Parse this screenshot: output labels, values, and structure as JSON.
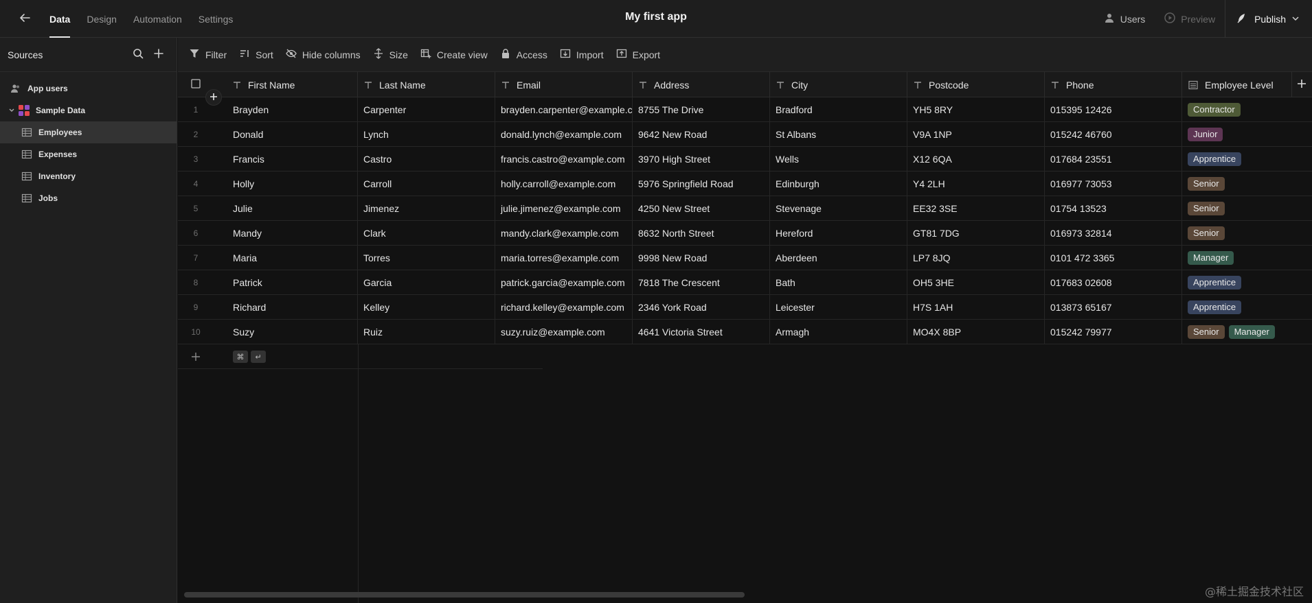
{
  "header": {
    "tabs": [
      "Data",
      "Design",
      "Automation",
      "Settings"
    ],
    "app_title": "My first app",
    "users_label": "Users",
    "preview_label": "Preview",
    "publish_label": "Publish"
  },
  "sidebar": {
    "title": "Sources",
    "items": [
      {
        "label": "App users",
        "icon": "users-icon"
      },
      {
        "label": "Sample Data",
        "icon": "database-icon"
      },
      {
        "label": "Employees",
        "icon": "table-icon"
      },
      {
        "label": "Expenses",
        "icon": "table-icon"
      },
      {
        "label": "Inventory",
        "icon": "table-icon"
      },
      {
        "label": "Jobs",
        "icon": "table-icon"
      }
    ]
  },
  "toolbar": {
    "filter": "Filter",
    "sort": "Sort",
    "hide_columns": "Hide columns",
    "size": "Size",
    "create_view": "Create view",
    "access": "Access",
    "import": "Import",
    "export": "Export"
  },
  "table": {
    "columns": [
      "First Name",
      "Last Name",
      "Email",
      "Address",
      "City",
      "Postcode",
      "Phone",
      "Employee Level"
    ],
    "rows": [
      {
        "n": "1",
        "first": "Brayden",
        "last": "Carpenter",
        "email": "brayden.carpenter@example.com",
        "address": "8755 The Drive",
        "city": "Bradford",
        "postcode": "YH5 8RY",
        "phone": "015395 12426",
        "levels": [
          "Contractor"
        ]
      },
      {
        "n": "2",
        "first": "Donald",
        "last": "Lynch",
        "email": "donald.lynch@example.com",
        "address": "9642 New Road",
        "city": "St Albans",
        "postcode": "V9A 1NP",
        "phone": "015242 46760",
        "levels": [
          "Junior"
        ]
      },
      {
        "n": "3",
        "first": "Francis",
        "last": "Castro",
        "email": "francis.castro@example.com",
        "address": "3970 High Street",
        "city": "Wells",
        "postcode": "X12 6QA",
        "phone": "017684 23551",
        "levels": [
          "Apprentice"
        ]
      },
      {
        "n": "4",
        "first": "Holly",
        "last": "Carroll",
        "email": "holly.carroll@example.com",
        "address": "5976 Springfield Road",
        "city": "Edinburgh",
        "postcode": "Y4 2LH",
        "phone": "016977 73053",
        "levels": [
          "Senior"
        ]
      },
      {
        "n": "5",
        "first": "Julie",
        "last": "Jimenez",
        "email": "julie.jimenez@example.com",
        "address": "4250 New Street",
        "city": "Stevenage",
        "postcode": "EE32 3SE",
        "phone": "01754 13523",
        "levels": [
          "Senior"
        ]
      },
      {
        "n": "6",
        "first": "Mandy",
        "last": "Clark",
        "email": "mandy.clark@example.com",
        "address": "8632 North Street",
        "city": "Hereford",
        "postcode": "GT81 7DG",
        "phone": "016973 32814",
        "levels": [
          "Senior"
        ]
      },
      {
        "n": "7",
        "first": "Maria",
        "last": "Torres",
        "email": "maria.torres@example.com",
        "address": "9998 New Road",
        "city": "Aberdeen",
        "postcode": "LP7 8JQ",
        "phone": "0101 472 3365",
        "levels": [
          "Manager"
        ]
      },
      {
        "n": "8",
        "first": "Patrick",
        "last": "Garcia",
        "email": "patrick.garcia@example.com",
        "address": "7818 The Crescent",
        "city": "Bath",
        "postcode": "OH5 3HE",
        "phone": "017683 02608",
        "levels": [
          "Apprentice"
        ]
      },
      {
        "n": "9",
        "first": "Richard",
        "last": "Kelley",
        "email": "richard.kelley@example.com",
        "address": "2346 York Road",
        "city": "Leicester",
        "postcode": "H7S 1AH",
        "phone": "013873 65167",
        "levels": [
          "Apprentice"
        ]
      },
      {
        "n": "10",
        "first": "Suzy",
        "last": "Ruiz",
        "email": "suzy.ruiz@example.com",
        "address": "4641 Victoria Street",
        "city": "Armagh",
        "postcode": "MO4X 8BP",
        "phone": "015242 79977",
        "levels": [
          "Senior",
          "Manager"
        ]
      }
    ]
  },
  "level_colors": {
    "Contractor": "#4e5a36",
    "Junior": "#5d3553",
    "Apprentice": "#38445e",
    "Senior": "#5a4738",
    "Manager": "#355a4c"
  },
  "shortcut_keys": [
    "⌘",
    "↵"
  ],
  "watermark": "@稀土掘金技术社区"
}
